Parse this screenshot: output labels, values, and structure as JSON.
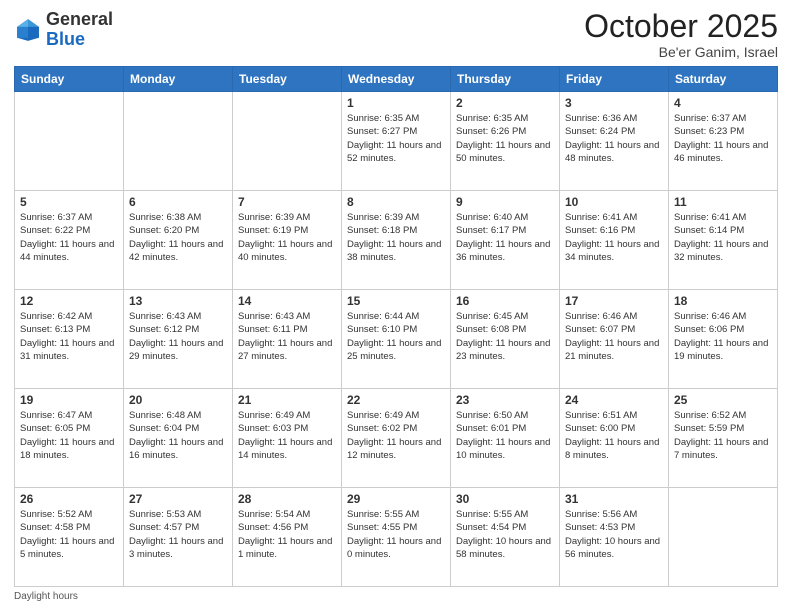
{
  "header": {
    "logo_general": "General",
    "logo_blue": "Blue",
    "month_title": "October 2025",
    "location": "Be'er Ganim, Israel"
  },
  "days_of_week": [
    "Sunday",
    "Monday",
    "Tuesday",
    "Wednesday",
    "Thursday",
    "Friday",
    "Saturday"
  ],
  "weeks": [
    [
      {
        "day": "",
        "info": ""
      },
      {
        "day": "",
        "info": ""
      },
      {
        "day": "",
        "info": ""
      },
      {
        "day": "1",
        "info": "Sunrise: 6:35 AM\nSunset: 6:27 PM\nDaylight: 11 hours\nand 52 minutes."
      },
      {
        "day": "2",
        "info": "Sunrise: 6:35 AM\nSunset: 6:26 PM\nDaylight: 11 hours\nand 50 minutes."
      },
      {
        "day": "3",
        "info": "Sunrise: 6:36 AM\nSunset: 6:24 PM\nDaylight: 11 hours\nand 48 minutes."
      },
      {
        "day": "4",
        "info": "Sunrise: 6:37 AM\nSunset: 6:23 PM\nDaylight: 11 hours\nand 46 minutes."
      }
    ],
    [
      {
        "day": "5",
        "info": "Sunrise: 6:37 AM\nSunset: 6:22 PM\nDaylight: 11 hours\nand 44 minutes."
      },
      {
        "day": "6",
        "info": "Sunrise: 6:38 AM\nSunset: 6:20 PM\nDaylight: 11 hours\nand 42 minutes."
      },
      {
        "day": "7",
        "info": "Sunrise: 6:39 AM\nSunset: 6:19 PM\nDaylight: 11 hours\nand 40 minutes."
      },
      {
        "day": "8",
        "info": "Sunrise: 6:39 AM\nSunset: 6:18 PM\nDaylight: 11 hours\nand 38 minutes."
      },
      {
        "day": "9",
        "info": "Sunrise: 6:40 AM\nSunset: 6:17 PM\nDaylight: 11 hours\nand 36 minutes."
      },
      {
        "day": "10",
        "info": "Sunrise: 6:41 AM\nSunset: 6:16 PM\nDaylight: 11 hours\nand 34 minutes."
      },
      {
        "day": "11",
        "info": "Sunrise: 6:41 AM\nSunset: 6:14 PM\nDaylight: 11 hours\nand 32 minutes."
      }
    ],
    [
      {
        "day": "12",
        "info": "Sunrise: 6:42 AM\nSunset: 6:13 PM\nDaylight: 11 hours\nand 31 minutes."
      },
      {
        "day": "13",
        "info": "Sunrise: 6:43 AM\nSunset: 6:12 PM\nDaylight: 11 hours\nand 29 minutes."
      },
      {
        "day": "14",
        "info": "Sunrise: 6:43 AM\nSunset: 6:11 PM\nDaylight: 11 hours\nand 27 minutes."
      },
      {
        "day": "15",
        "info": "Sunrise: 6:44 AM\nSunset: 6:10 PM\nDaylight: 11 hours\nand 25 minutes."
      },
      {
        "day": "16",
        "info": "Sunrise: 6:45 AM\nSunset: 6:08 PM\nDaylight: 11 hours\nand 23 minutes."
      },
      {
        "day": "17",
        "info": "Sunrise: 6:46 AM\nSunset: 6:07 PM\nDaylight: 11 hours\nand 21 minutes."
      },
      {
        "day": "18",
        "info": "Sunrise: 6:46 AM\nSunset: 6:06 PM\nDaylight: 11 hours\nand 19 minutes."
      }
    ],
    [
      {
        "day": "19",
        "info": "Sunrise: 6:47 AM\nSunset: 6:05 PM\nDaylight: 11 hours\nand 18 minutes."
      },
      {
        "day": "20",
        "info": "Sunrise: 6:48 AM\nSunset: 6:04 PM\nDaylight: 11 hours\nand 16 minutes."
      },
      {
        "day": "21",
        "info": "Sunrise: 6:49 AM\nSunset: 6:03 PM\nDaylight: 11 hours\nand 14 minutes."
      },
      {
        "day": "22",
        "info": "Sunrise: 6:49 AM\nSunset: 6:02 PM\nDaylight: 11 hours\nand 12 minutes."
      },
      {
        "day": "23",
        "info": "Sunrise: 6:50 AM\nSunset: 6:01 PM\nDaylight: 11 hours\nand 10 minutes."
      },
      {
        "day": "24",
        "info": "Sunrise: 6:51 AM\nSunset: 6:00 PM\nDaylight: 11 hours\nand 8 minutes."
      },
      {
        "day": "25",
        "info": "Sunrise: 6:52 AM\nSunset: 5:59 PM\nDaylight: 11 hours\nand 7 minutes."
      }
    ],
    [
      {
        "day": "26",
        "info": "Sunrise: 5:52 AM\nSunset: 4:58 PM\nDaylight: 11 hours\nand 5 minutes."
      },
      {
        "day": "27",
        "info": "Sunrise: 5:53 AM\nSunset: 4:57 PM\nDaylight: 11 hours\nand 3 minutes."
      },
      {
        "day": "28",
        "info": "Sunrise: 5:54 AM\nSunset: 4:56 PM\nDaylight: 11 hours\nand 1 minute."
      },
      {
        "day": "29",
        "info": "Sunrise: 5:55 AM\nSunset: 4:55 PM\nDaylight: 11 hours\nand 0 minutes."
      },
      {
        "day": "30",
        "info": "Sunrise: 5:55 AM\nSunset: 4:54 PM\nDaylight: 10 hours\nand 58 minutes."
      },
      {
        "day": "31",
        "info": "Sunrise: 5:56 AM\nSunset: 4:53 PM\nDaylight: 10 hours\nand 56 minutes."
      },
      {
        "day": "",
        "info": ""
      }
    ]
  ],
  "footer": {
    "daylight_hours_label": "Daylight hours"
  }
}
